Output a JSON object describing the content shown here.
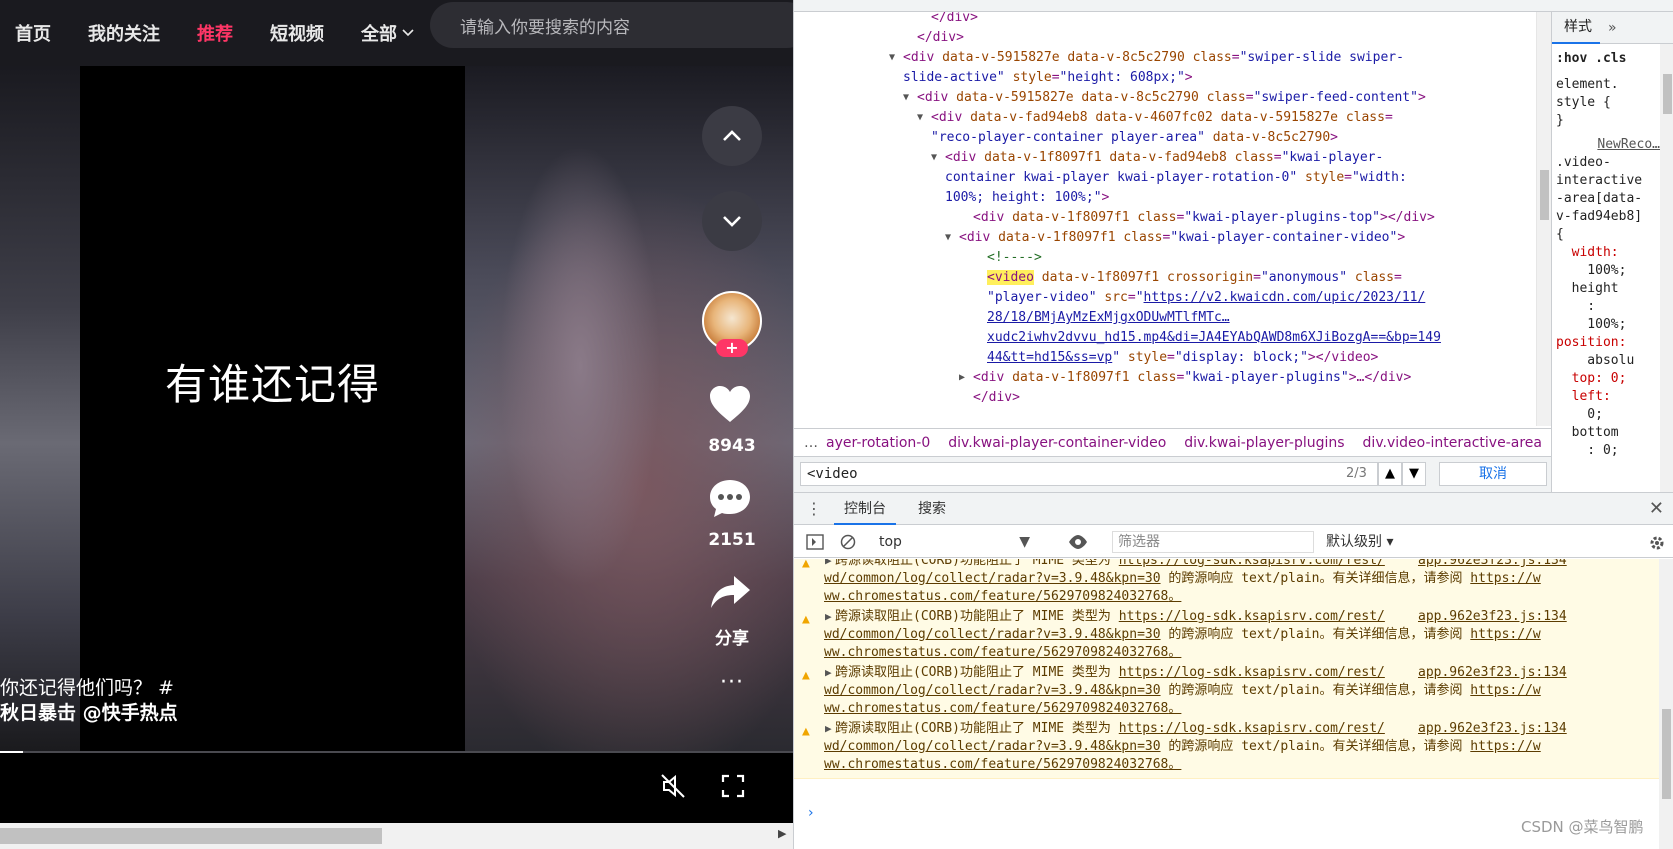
{
  "nav": {
    "items": [
      "首页",
      "我的关注",
      "推荐",
      "短视频",
      "全部"
    ],
    "active_index": 2,
    "search_placeholder": "请输入你要搜索的内容"
  },
  "video": {
    "caption": "有谁还记得",
    "desc_line1": "你还记得他们吗？ #",
    "desc_line2": "秋日暴击 @快手热点",
    "likes": "8943",
    "comments": "2151",
    "share_label": "分享",
    "follow_label": "+",
    "more_label": "···"
  },
  "devtools": {
    "elements_lines": [
      {
        "indent": 930,
        "html": [
          [
            "tag",
            "</div>"
          ]
        ]
      },
      {
        "indent": 916,
        "html": [
          [
            "tag",
            "</div>"
          ]
        ]
      },
      {
        "indent": 902,
        "arrow": "▼",
        "html": [
          [
            "tag",
            "<div "
          ],
          [
            "an",
            "data-v-5915827e data-v-8c5c2790 class"
          ],
          [
            "tag",
            "="
          ],
          [
            "av",
            "\"swiper-slide swiper-"
          ]
        ]
      },
      {
        "indent": 902,
        "html": [
          [
            "av",
            "slide-active\""
          ],
          [
            "an",
            " style"
          ],
          [
            "tag",
            "="
          ],
          [
            "av",
            "\"height: 608px;\""
          ],
          [
            "tag",
            ">"
          ]
        ]
      },
      {
        "indent": 916,
        "arrow": "▼",
        "html": [
          [
            "tag",
            "<div "
          ],
          [
            "an",
            "data-v-5915827e data-v-8c5c2790 class"
          ],
          [
            "tag",
            "="
          ],
          [
            "av",
            "\"swiper-feed-content\""
          ],
          [
            "tag",
            ">"
          ]
        ]
      },
      {
        "indent": 930,
        "arrow": "▼",
        "html": [
          [
            "tag",
            "<div "
          ],
          [
            "an",
            "data-v-fad94eb8 data-v-4607fc02 data-v-5915827e class"
          ],
          [
            "tag",
            "="
          ]
        ]
      },
      {
        "indent": 930,
        "html": [
          [
            "av",
            "\"reco-player-container player-area\""
          ],
          [
            "an",
            " data-v-8c5c2790"
          ],
          [
            "tag",
            ">"
          ]
        ]
      },
      {
        "indent": 944,
        "arrow": "▼",
        "html": [
          [
            "tag",
            "<div "
          ],
          [
            "an",
            "data-v-1f8097f1 data-v-fad94eb8 class"
          ],
          [
            "tag",
            "="
          ],
          [
            "av",
            "\"kwai-player-"
          ]
        ]
      },
      {
        "indent": 944,
        "html": [
          [
            "av",
            "container kwai-player kwai-player-rotation-0\""
          ],
          [
            "an",
            " style"
          ],
          [
            "tag",
            "="
          ],
          [
            "av",
            "\"width:"
          ]
        ]
      },
      {
        "indent": 944,
        "html": [
          [
            "av",
            "100%; height: 100%;\""
          ],
          [
            "tag",
            ">"
          ]
        ]
      },
      {
        "indent": 972,
        "html": [
          [
            "tag",
            "<div "
          ],
          [
            "an",
            "data-v-1f8097f1 class"
          ],
          [
            "tag",
            "="
          ],
          [
            "av",
            "\"kwai-player-plugins-top\""
          ],
          [
            "tag",
            "></div>"
          ]
        ]
      },
      {
        "indent": 958,
        "arrow": "▼",
        "html": [
          [
            "tag",
            "<div "
          ],
          [
            "an",
            "data-v-1f8097f1 class"
          ],
          [
            "tag",
            "="
          ],
          [
            "av",
            "\"kwai-player-container-video\""
          ],
          [
            "tag",
            ">"
          ]
        ]
      },
      {
        "indent": 986,
        "html": [
          [
            "cm",
            "<!---->"
          ]
        ]
      },
      {
        "indent": 986,
        "html": [
          [
            "hl",
            "<video"
          ],
          [
            "an",
            " data-v-1f8097f1 crossorigin"
          ],
          [
            "tag",
            "="
          ],
          [
            "av",
            "\"anonymous\""
          ],
          [
            "an",
            " class"
          ],
          [
            "tag",
            "="
          ]
        ]
      },
      {
        "indent": 986,
        "html": [
          [
            "av",
            "\"player-video\""
          ],
          [
            "an",
            " src"
          ],
          [
            "tag",
            "="
          ],
          [
            "av",
            "\""
          ],
          [
            "lnk",
            "https://v2.kwaicdn.com/upic/2023/11/"
          ]
        ]
      },
      {
        "indent": 986,
        "html": [
          [
            "lnk",
            "28/18/BMjAyMzExMjgxODUwMTlfMTc…"
          ]
        ]
      },
      {
        "indent": 986,
        "html": [
          [
            "lnk",
            "xudc2iwhv2dvvu_hd15.mp4&di=JA4EYAbQAWD8m6XJiBozgA==&bp=149"
          ]
        ]
      },
      {
        "indent": 986,
        "html": [
          [
            "lnk",
            "44&tt=hd15&ss=vp"
          ],
          [
            "av",
            "\""
          ],
          [
            "an",
            " style"
          ],
          [
            "tag",
            "="
          ],
          [
            "av",
            "\"display: block;\""
          ],
          [
            "tag",
            "></video>"
          ]
        ]
      },
      {
        "indent": 972,
        "arrow": "▶",
        "html": [
          [
            "tag",
            "<div "
          ],
          [
            "an",
            "data-v-1f8097f1 class"
          ],
          [
            "tag",
            "="
          ],
          [
            "av",
            "\"kwai-player-plugins\""
          ],
          [
            "tag",
            ">…</div>"
          ]
        ]
      },
      {
        "indent": 972,
        "html": [
          [
            "tag",
            "</div>"
          ]
        ]
      }
    ],
    "breadcrumb": [
      "…",
      "ayer-rotation-0",
      "div.kwai-player-container-video",
      "div.kwai-player-plugins",
      "div.video-interactive-area",
      "…"
    ],
    "find_value": "<video",
    "find_count": "2/3",
    "cancel_label": "取消",
    "styles_tab": "样式",
    "styles_more": "»",
    "styles_lines": [
      ":hov .cls",
      "element.",
      "style {",
      "}",
      "NewReco…",
      ".video-",
      "interactive",
      "-area[data-",
      "v-fad94eb8]",
      "{",
      "  width:",
      "    100%;",
      "  height",
      "    :",
      "    100%;",
      "position:",
      "    absolu",
      "  top: 0;",
      "  left:",
      "    0;",
      "  bottom",
      "    : 0;"
    ],
    "console_tabs": [
      "控制台",
      "搜索"
    ],
    "context": "top",
    "filter_placeholder": "筛选器",
    "level": "默认级别 ▾",
    "message": {
      "text": "跨源读取阻止(CORB)功能阻止了 MIME 类型为 ",
      "url": "https://log-sdk.ksapisrv.com/rest/",
      "src": "app.962e3f23.js:134",
      "line2a": "wd/common/log/collect/radar?v=3.9.48&kpn=30",
      "line2b": " 的跨源响应 text/plain。有关详细信息，请参阅 ",
      "line2c": "https://w",
      "line3": "ww.chromestatus.com/feature/5629709824032768",
      "line3b": "。"
    },
    "prompt": "›",
    "watermark": "CSDN @菜鸟智鹏"
  },
  "colors": {
    "accent": "#fe3666",
    "devtools_blue": "#1a73e8",
    "warning_bg": "#fffbe5"
  }
}
